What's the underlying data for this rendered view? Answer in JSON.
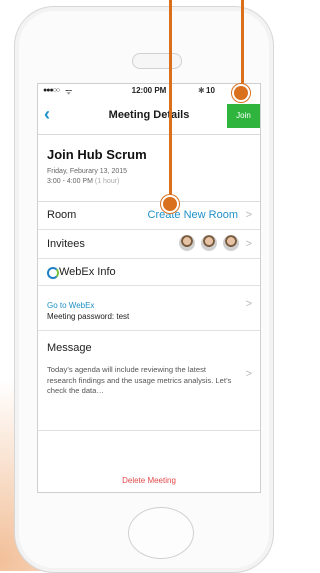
{
  "status_bar": {
    "signal": "●●●○○",
    "wifi": "ᯤ",
    "time": "12:00 PM",
    "battery_text": "10"
  },
  "navbar": {
    "back_icon": "‹",
    "title": "Meeting Details",
    "join_label": "Join"
  },
  "meeting": {
    "title": "Join Hub Scrum",
    "date": "Friday, Feburary 13, 2015",
    "time": "3:00 - 4:00 PM",
    "duration": "(1 hour)"
  },
  "room": {
    "label": "Room",
    "action": "Create New Room"
  },
  "invitees": {
    "label": "Invitees"
  },
  "webex": {
    "header": "WebEx Info",
    "link": "Go to WebEx",
    "password": "Meeting password: test"
  },
  "message": {
    "label": "Message",
    "body": "Today’s agenda will include reviewing the latest research findings and the usage metrics analysis. Let’s check the data…"
  },
  "delete_label": "Delete Meeting",
  "chevron": ">",
  "accent_colors": {
    "join_green": "#2fb43e",
    "link_blue": "#1e90c8",
    "delete_red": "#e0484a",
    "callout_orange": "#d9701e"
  }
}
